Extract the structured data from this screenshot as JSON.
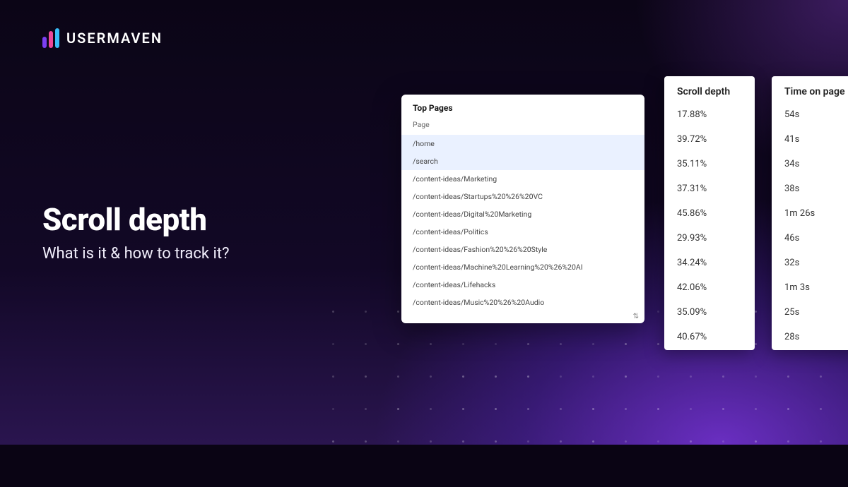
{
  "brand": {
    "name": "USERMAVEN"
  },
  "headline": {
    "title": "Scroll depth",
    "subtitle": "What is it & how to track it?"
  },
  "top_pages": {
    "title": "Top Pages",
    "column_label": "Page",
    "rows": [
      {
        "path": "/home",
        "highlight": true
      },
      {
        "path": "/search",
        "highlight": true
      },
      {
        "path": "/content-ideas/Marketing",
        "highlight": false
      },
      {
        "path": "/content-ideas/Startups%20%26%20VC",
        "highlight": false
      },
      {
        "path": "/content-ideas/Digital%20Marketing",
        "highlight": false
      },
      {
        "path": "/content-ideas/Politics",
        "highlight": false
      },
      {
        "path": "/content-ideas/Fashion%20%26%20Style",
        "highlight": false
      },
      {
        "path": "/content-ideas/Machine%20Learning%20%26%20AI",
        "highlight": false
      },
      {
        "path": "/content-ideas/Lifehacks",
        "highlight": false
      },
      {
        "path": "/content-ideas/Music%20%26%20Audio",
        "highlight": false
      }
    ]
  },
  "scroll_depth": {
    "title": "Scroll depth",
    "values": [
      "17.88%",
      "39.72%",
      "35.11%",
      "37.31%",
      "45.86%",
      "29.93%",
      "34.24%",
      "42.06%",
      "35.09%",
      "40.67%"
    ]
  },
  "time_on_page": {
    "title": "Time on page",
    "values": [
      "54s",
      "41s",
      "34s",
      "38s",
      "1m 26s",
      "46s",
      "32s",
      "1m 3s",
      "25s",
      "28s"
    ]
  }
}
